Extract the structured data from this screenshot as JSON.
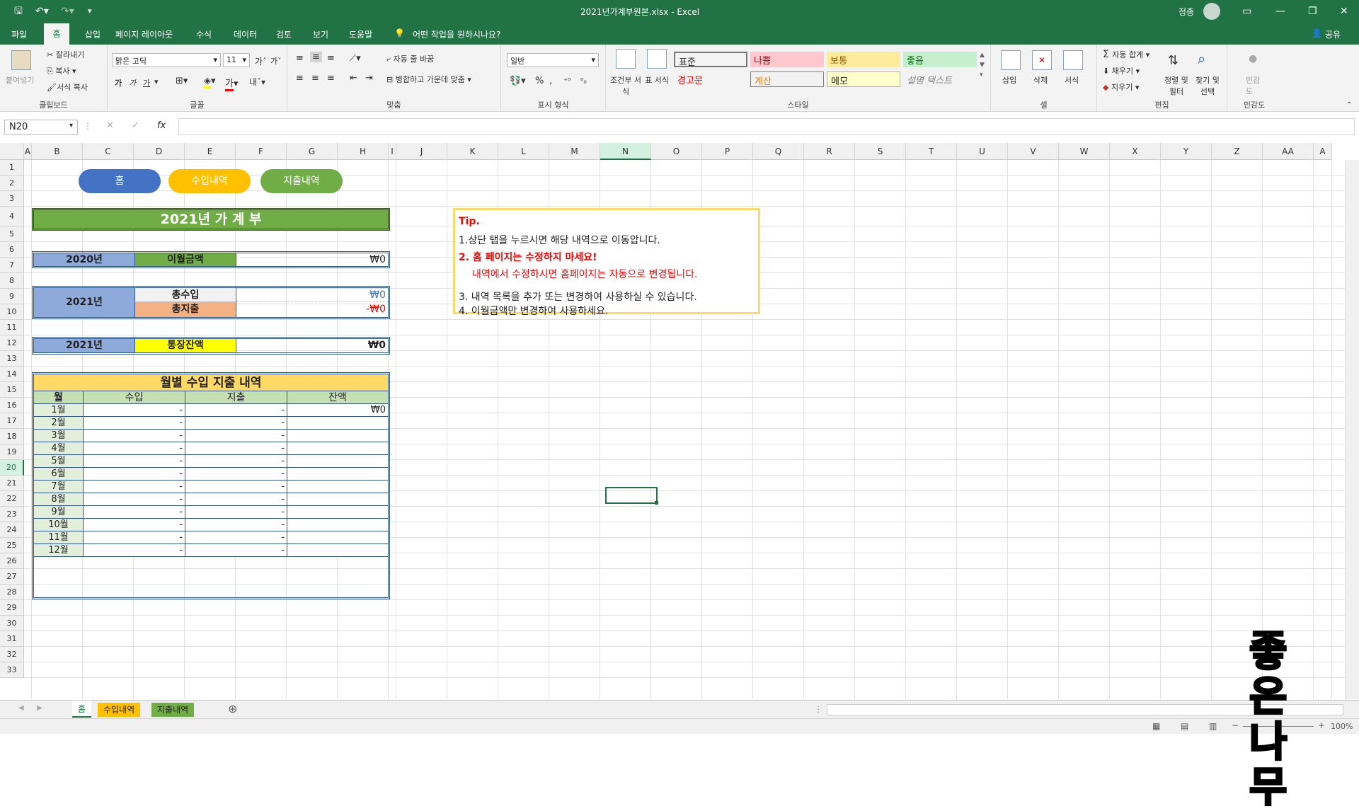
{
  "window": {
    "title": "2021년가계부원본.xlsx  -  Excel",
    "user": "정종"
  },
  "menu": {
    "items": [
      "파일",
      "홈",
      "삽입",
      "페이지 레이아웃",
      "수식",
      "데이터",
      "검토",
      "보기",
      "도움말"
    ],
    "tell_me": "어떤 작업을 원하시나요?",
    "share": "공유"
  },
  "ribbon": {
    "clipboard": {
      "label": "클립보드",
      "paste": "붙여넣기",
      "cut": "잘라내기",
      "copy": "복사",
      "format_painter": "서식 복사"
    },
    "font": {
      "label": "글꼴",
      "name": "맑은 고딕",
      "size": "11",
      "bold": "가",
      "italic": "가",
      "underline": "가"
    },
    "alignment": {
      "label": "맞춤",
      "wrap": "자동 줄 바꿈",
      "merge": "병합하고 가운데 맞춤"
    },
    "number": {
      "label": "표시 형식",
      "format": "일반",
      "percent": "%"
    },
    "styles": {
      "label": "스타일",
      "conditional": "조건부 서식",
      "table": "표 서식",
      "cells": [
        {
          "text": "표준",
          "bg": "#ffffff",
          "fg": "#000000"
        },
        {
          "text": "나쁨",
          "bg": "#ffc7ce",
          "fg": "#9c0006"
        },
        {
          "text": "보통",
          "bg": "#ffeb9c",
          "fg": "#9c5700"
        },
        {
          "text": "좋음",
          "bg": "#c6efce",
          "fg": "#006100"
        },
        {
          "text": "경고문",
          "bg": "#ffffff",
          "fg": "#ff0000"
        },
        {
          "text": "계산",
          "bg": "#f2f2f2",
          "fg": "#fa7d00"
        },
        {
          "text": "메모",
          "bg": "#ffffcc",
          "fg": "#000000"
        },
        {
          "text": "설명 텍스트",
          "bg": "#ffffff",
          "fg": "#7f7f7f"
        }
      ]
    },
    "cells": {
      "label": "셀",
      "insert": "삽입",
      "delete": "삭제",
      "format": "서식"
    },
    "editing": {
      "label": "편집",
      "autosum": "자동 합계",
      "fill": "채우기",
      "clear": "지우기",
      "sort": "정렬 및 필터",
      "find": "찾기 및 선택"
    },
    "sensitivity": {
      "label": "민감도",
      "btn": "민감도"
    }
  },
  "formula": {
    "namebox": "N20",
    "fx": "fx",
    "value": ""
  },
  "columns": [
    "A",
    "B",
    "C",
    "D",
    "E",
    "F",
    "G",
    "H",
    "I",
    "J",
    "K",
    "L",
    "M",
    "N",
    "O",
    "P",
    "Q",
    "R",
    "S",
    "T",
    "U",
    "V",
    "W",
    "X",
    "Y",
    "Z",
    "AA",
    "A"
  ],
  "rows": [
    "1",
    "2",
    "3",
    "4",
    "5",
    "6",
    "7",
    "8",
    "9",
    "10",
    "11",
    "12",
    "13",
    "14",
    "15",
    "16",
    "17",
    "18",
    "19",
    "20",
    "21",
    "22",
    "23",
    "24",
    "25",
    "26",
    "27",
    "28",
    "29",
    "30",
    "31",
    "32",
    "33"
  ],
  "nav": {
    "home": "홈",
    "income": "수입내역",
    "expense": "지출내역"
  },
  "ledger": {
    "title": "2021년  가 계 부",
    "carry_year": "2020년",
    "carry_label": "이월금액",
    "carry_value": "₩0",
    "year_2021": "2021년",
    "total_income_label": "총수입",
    "total_income_value": "₩0",
    "total_expense_label": "총지출",
    "total_expense_value": "-₩0",
    "balance_year": "2021년",
    "balance_label": "통장잔액",
    "balance_value": "₩0"
  },
  "monthly": {
    "title": "월별 수입 지출 내역",
    "headers": [
      "월",
      "수입",
      "지출",
      "잔액"
    ],
    "rows": [
      {
        "m": "1월",
        "inc": "-",
        "exp": "-",
        "bal": "₩0"
      },
      {
        "m": "2월",
        "inc": "-",
        "exp": "-",
        "bal": ""
      },
      {
        "m": "3월",
        "inc": "-",
        "exp": "-",
        "bal": ""
      },
      {
        "m": "4월",
        "inc": "-",
        "exp": "-",
        "bal": ""
      },
      {
        "m": "5월",
        "inc": "-",
        "exp": "-",
        "bal": ""
      },
      {
        "m": "6월",
        "inc": "-",
        "exp": "-",
        "bal": ""
      },
      {
        "m": "7월",
        "inc": "-",
        "exp": "-",
        "bal": ""
      },
      {
        "m": "8월",
        "inc": "-",
        "exp": "-",
        "bal": ""
      },
      {
        "m": "9월",
        "inc": "-",
        "exp": "-",
        "bal": ""
      },
      {
        "m": "10월",
        "inc": "-",
        "exp": "-",
        "bal": ""
      },
      {
        "m": "11월",
        "inc": "-",
        "exp": "-",
        "bal": ""
      },
      {
        "m": "12월",
        "inc": "-",
        "exp": "-",
        "bal": ""
      }
    ]
  },
  "tip": {
    "title": "Tip.",
    "line1": "1.상단 탭을 누르시면 해당 내역으로 이동압니다.",
    "line2": "2. 홈 페이지는 수정하지 마세요!",
    "line2b": "내역에서 수정하시면 홈페이지는 자동으로 변경됩니다.",
    "line3": "3. 내역 목록을 추가 또는 변경하여 사용하실 수 있습니다.",
    "line4": "4. 이월금액만 변경하여 사용하세요."
  },
  "sheet_tabs": [
    "홈",
    "수입내역",
    "지출내역"
  ],
  "status": {
    "zoom": "100%"
  },
  "watermark": "좋은나무"
}
